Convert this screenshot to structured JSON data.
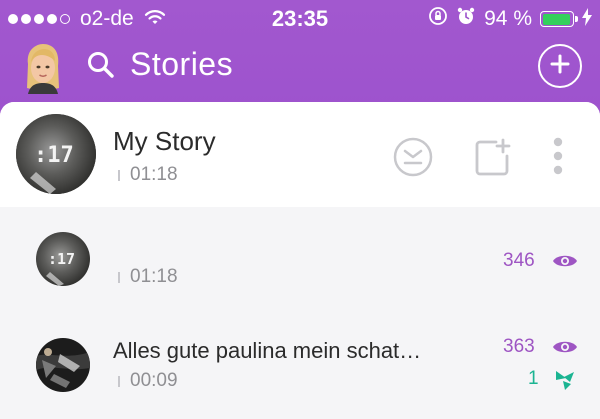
{
  "status_bar": {
    "carrier": "o2-de",
    "time": "23:35",
    "battery_percent": "94 %",
    "battery_level": 0.94,
    "icons": [
      "signal-dots",
      "wifi-icon",
      "orientation-lock-icon",
      "alarm-icon",
      "battery-icon",
      "charging-bolt-icon"
    ]
  },
  "header": {
    "title": "Stories",
    "search_icon": "search-icon",
    "add_icon": "plus-circle-icon",
    "avatar": "bitmoji-avatar"
  },
  "my_story": {
    "name": "My Story",
    "time": "01:18",
    "actions": [
      "save-story-icon",
      "add-to-story-icon",
      "more-options-icon"
    ]
  },
  "story_items": [
    {
      "title": "",
      "time": "01:18",
      "views": "346",
      "screenshots": ""
    },
    {
      "title": "Alles gute paulina mein schat…",
      "time": "00:09",
      "views": "363",
      "screenshots": "1"
    }
  ],
  "colors": {
    "header_gradient_top": "#a258cf",
    "view_count": "#9e55c3",
    "screenshot_count": "#1bb492",
    "battery_green": "#34d05c"
  }
}
